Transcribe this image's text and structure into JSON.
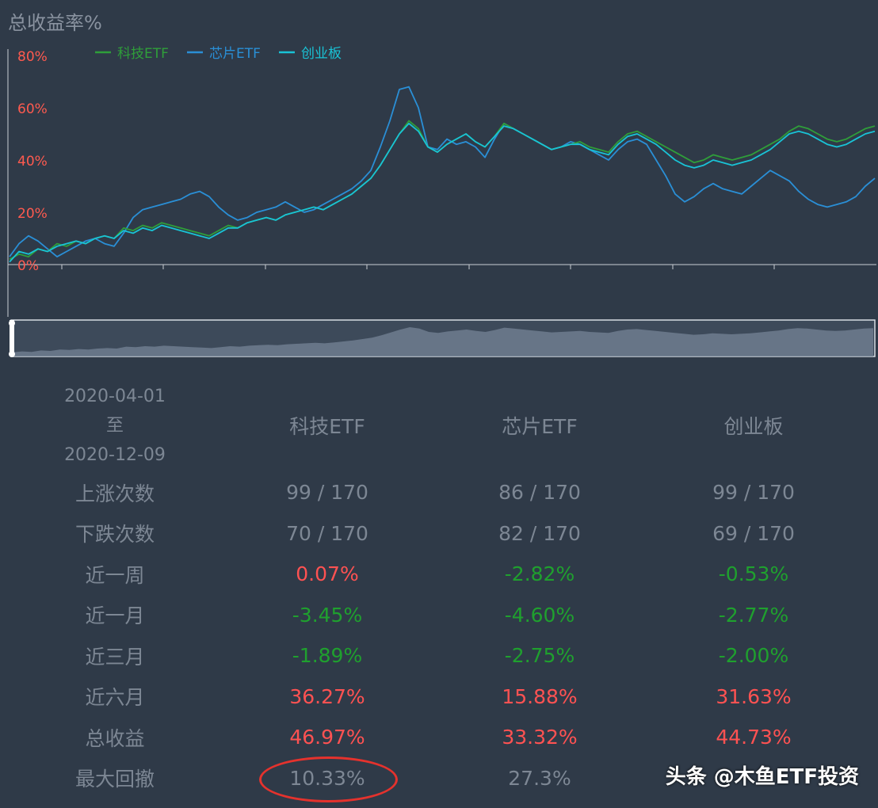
{
  "chart_data": {
    "type": "line",
    "title": "总收益率%",
    "y_ticks": [
      "80%",
      "60%",
      "40%",
      "20%",
      "0%"
    ],
    "ylim": [
      0,
      80
    ],
    "grid": false,
    "legend_position": "top-left",
    "x_start": "2020-04-01",
    "x_end": "2020-12-09",
    "series": [
      {
        "name": "科技ETF",
        "color": "#2f9e3a",
        "values": [
          2,
          4,
          3,
          6,
          5,
          8,
          7,
          9,
          8,
          10,
          11,
          10,
          14,
          13,
          15,
          14,
          16,
          15,
          14,
          13,
          12,
          11,
          13,
          15,
          14,
          16,
          17,
          18,
          17,
          19,
          20,
          21,
          22,
          21,
          23,
          25,
          27,
          30,
          33,
          38,
          44,
          50,
          55,
          52,
          45,
          43,
          46,
          48,
          50,
          47,
          45,
          49,
          54,
          52,
          50,
          48,
          46,
          44,
          45,
          46,
          47,
          45,
          44,
          43,
          47,
          50,
          51,
          49,
          47,
          45,
          43,
          41,
          39,
          40,
          42,
          41,
          40,
          41,
          42,
          44,
          46,
          48,
          51,
          53,
          52,
          50,
          48,
          47,
          48,
          50,
          52,
          53
        ]
      },
      {
        "name": "芯片ETF",
        "color": "#2a8fd6",
        "values": [
          3,
          8,
          11,
          9,
          6,
          3,
          5,
          7,
          9,
          10,
          8,
          7,
          12,
          18,
          21,
          22,
          23,
          24,
          25,
          27,
          28,
          26,
          22,
          19,
          17,
          18,
          20,
          21,
          22,
          24,
          22,
          20,
          21,
          23,
          25,
          27,
          29,
          32,
          36,
          45,
          55,
          67,
          68,
          60,
          45,
          44,
          48,
          46,
          47,
          45,
          41,
          48,
          54,
          52,
          50,
          48,
          46,
          44,
          45,
          47,
          46,
          44,
          42,
          40,
          44,
          47,
          48,
          46,
          40,
          34,
          27,
          24,
          26,
          29,
          31,
          29,
          28,
          27,
          30,
          33,
          36,
          34,
          32,
          28,
          25,
          23,
          22,
          23,
          24,
          26,
          30,
          33
        ]
      },
      {
        "name": "创业板",
        "color": "#19c3d6",
        "values": [
          1,
          5,
          4,
          6,
          5,
          7,
          8,
          9,
          8,
          10,
          11,
          10,
          13,
          12,
          14,
          13,
          15,
          14,
          13,
          12,
          11,
          10,
          12,
          14,
          14,
          16,
          17,
          18,
          17,
          19,
          20,
          21,
          22,
          21,
          23,
          25,
          27,
          30,
          33,
          38,
          44,
          50,
          54,
          51,
          45,
          43,
          46,
          48,
          50,
          47,
          45,
          49,
          53,
          52,
          50,
          48,
          46,
          44,
          45,
          46,
          46,
          44,
          43,
          42,
          46,
          49,
          50,
          48,
          46,
          43,
          40,
          38,
          37,
          38,
          40,
          39,
          38,
          39,
          40,
          42,
          44,
          47,
          50,
          51,
          50,
          48,
          46,
          45,
          46,
          48,
          50,
          51
        ]
      }
    ]
  },
  "table": {
    "period_start": "2020-04-01",
    "period_to": "至",
    "period_end": "2020-12-09",
    "columns": [
      "科技ETF",
      "芯片ETF",
      "创业板"
    ],
    "rows": [
      {
        "label": "上涨次数",
        "values": [
          "99 / 170",
          "86 / 170",
          "99 / 170"
        ],
        "colors": [
          "gray",
          "gray",
          "gray"
        ]
      },
      {
        "label": "下跌次数",
        "values": [
          "70 / 170",
          "82 / 170",
          "69 / 170"
        ],
        "colors": [
          "gray",
          "gray",
          "gray"
        ]
      },
      {
        "label": "近一周",
        "values": [
          "0.07%",
          "-2.82%",
          "-0.53%"
        ],
        "colors": [
          "red",
          "green",
          "green"
        ]
      },
      {
        "label": "近一月",
        "values": [
          "-3.45%",
          "-4.60%",
          "-2.77%"
        ],
        "colors": [
          "green",
          "green",
          "green"
        ]
      },
      {
        "label": "近三月",
        "values": [
          "-1.89%",
          "-2.75%",
          "-2.00%"
        ],
        "colors": [
          "green",
          "green",
          "green"
        ]
      },
      {
        "label": "近六月",
        "values": [
          "36.27%",
          "15.88%",
          "31.63%"
        ],
        "colors": [
          "red",
          "red",
          "red"
        ]
      },
      {
        "label": "总收益",
        "values": [
          "46.97%",
          "33.32%",
          "44.73%"
        ],
        "colors": [
          "red",
          "red",
          "red"
        ]
      },
      {
        "label": "最大回撤",
        "values": [
          "10.33%",
          "27.3%",
          ""
        ],
        "colors": [
          "gray",
          "gray",
          "gray"
        ]
      }
    ]
  },
  "watermark": "头条 @木鱼ETF投资",
  "colors": {
    "background": "#2f3a48",
    "axis_tick_label": "#ff5a4f",
    "highlight_circle": "#e5322d"
  }
}
